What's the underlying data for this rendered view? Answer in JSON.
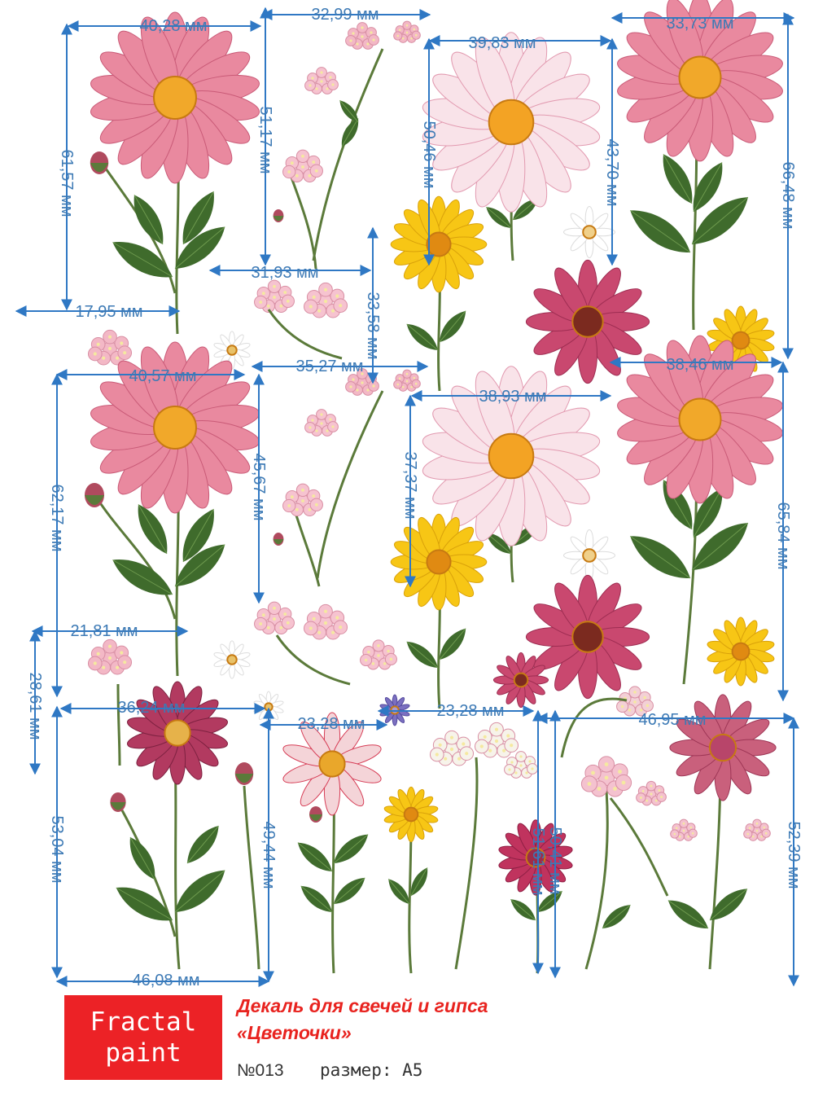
{
  "colors": {
    "dimension": "#3d7ab5",
    "brand": "#ec2226",
    "title": "#e8231f",
    "text": "#333333"
  },
  "dimensions_horizontal": [
    "40,28 мм",
    "32,99 мм",
    "39,83 мм",
    "33,73 мм",
    "31,93 мм",
    "17,95 мм",
    "40,57 мм",
    "35,27 мм",
    "38,93 мм",
    "38,46 мм",
    "21,81 мм",
    "36,24 мм",
    "23,28 мм",
    "23,28 мм",
    "46,95 мм",
    "46,08 мм"
  ],
  "dimensions_vertical": [
    "61,57 мм",
    "51,17 мм",
    "50,46 мм",
    "43,70 мм",
    "66,48 мм",
    "33,58 мм",
    "62,17 мм",
    "45,67 мм",
    "37,37 мм",
    "65,84 мм",
    "28,61 мм",
    "53,04 мм",
    "49,44 мм",
    "51,61 мм",
    "50,41 мм",
    "52,39 мм"
  ],
  "brand": {
    "line1": "Fractal",
    "line2": "paint"
  },
  "product": {
    "title_line1": "Декаль для свечей и гипса",
    "title_line2": "«Цветочки»",
    "number": "№013",
    "size": "размер: А5"
  }
}
